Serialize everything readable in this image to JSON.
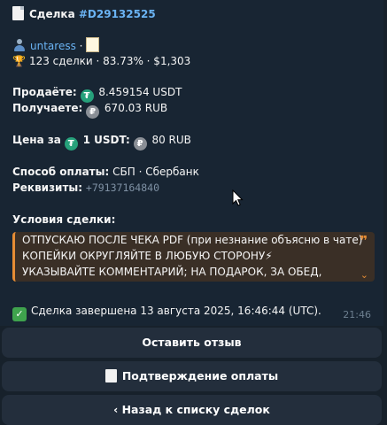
{
  "deal": {
    "label": "Сделка",
    "id": "#D29132525"
  },
  "seller": {
    "username": "untaress",
    "separator": "·",
    "stats": "123 сделки · 83.73% · $1,303"
  },
  "trade": {
    "sell_label": "Продаёте:",
    "sell_value": "8.459154 USDT",
    "receive_label": "Получаете:",
    "receive_value": "670.03 RUB"
  },
  "price": {
    "label": "Цена за",
    "unit": "1 USDT:",
    "value": "80 RUB"
  },
  "payment": {
    "method_label": "Способ оплаты:",
    "method_value": "СБП · Сбербанк",
    "details_label": "Реквизиты:",
    "details_value": "+79137164840"
  },
  "conditions": {
    "label": "Условия сделки:",
    "lines": [
      "ОТПУСКАЮ ПОСЛЕ ЧЕКА PDF (при незнание объясню в чате)",
      "КОПЕЙКИ ОКРУГЛЯЙТЕ В ЛЮБУЮ СТОРОНУ⚡",
      "УКАЗЫВАЙТЕ КОММЕНТАРИЙ; НА ПОДАРОК, ЗА ОБЕД,"
    ]
  },
  "status": {
    "text": "Сделка завершена 13 августа 2025, 16:46:44 (UTC).",
    "time": "21:46"
  },
  "buttons": {
    "review": "Оставить отзыв",
    "confirm": "Подтверждение оплаты",
    "back": "‹ Назад к списку сделок"
  },
  "icons": {
    "usdt": "₮",
    "rub": "₽",
    "check": "✓",
    "quote": "❞",
    "chevron": "⌄",
    "trophy": "🏆"
  }
}
